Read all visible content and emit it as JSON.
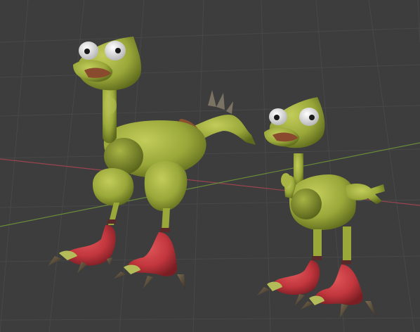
{
  "viewport": {
    "background": "#3d3d3d",
    "grid_color": "#484848",
    "x_axis_color": "#9a4450",
    "y_axis_color": "#6a8a3a"
  },
  "scene": {
    "objects": [
      {
        "kind": "creature",
        "variant": "tall-long-neck",
        "skin": "#9aa83a",
        "feet": "#c2363d"
      },
      {
        "kind": "creature",
        "variant": "short-arms-out",
        "skin": "#9aa83a",
        "feet": "#c2363d"
      }
    ]
  }
}
